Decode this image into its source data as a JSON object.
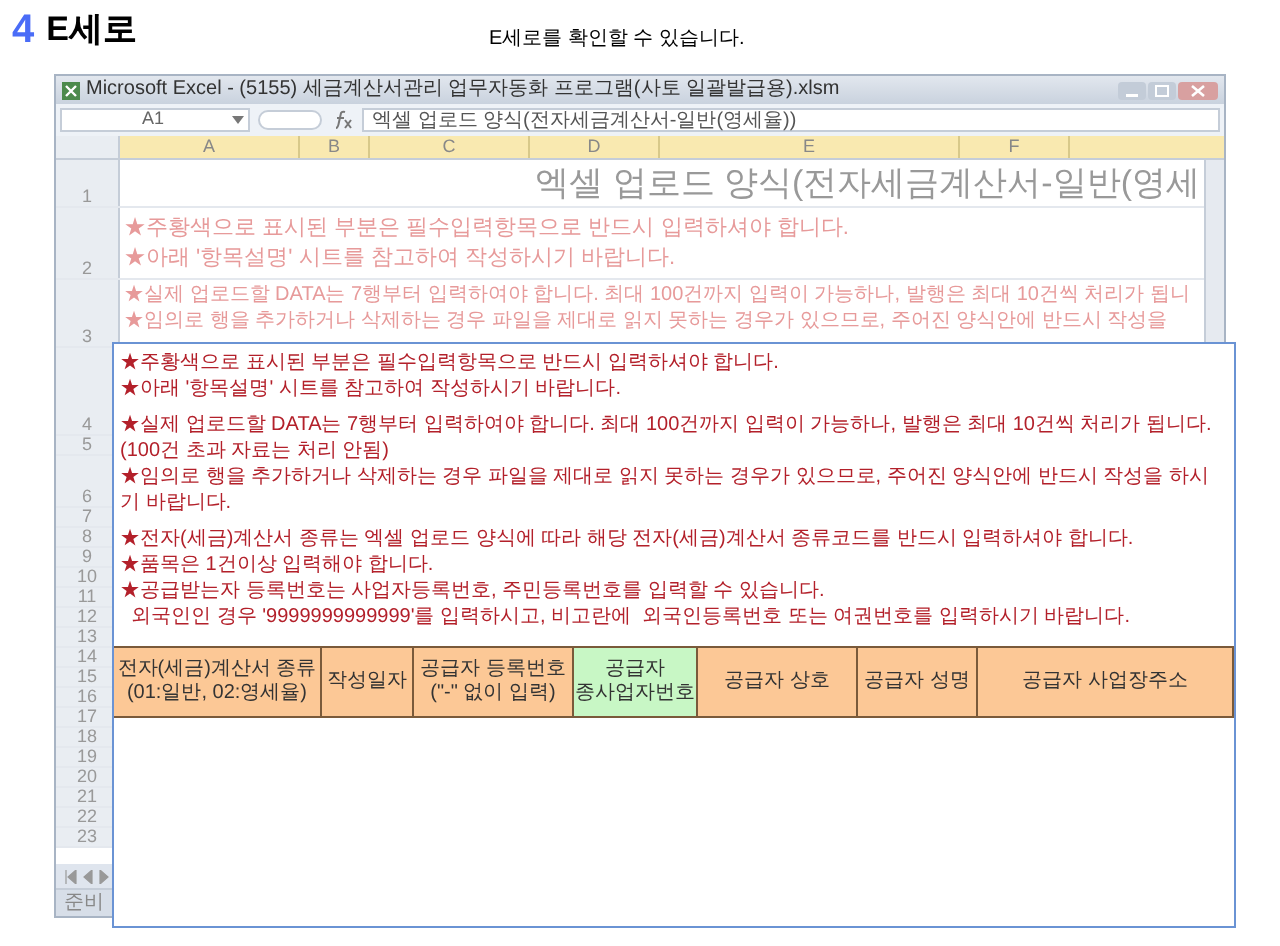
{
  "page": {
    "step_number": "4",
    "title": "E세로",
    "caption": "E세로를 확인할 수 있습니다."
  },
  "excel": {
    "title": "Microsoft Excel - (5155) 세금계산서관리 업무자동화 프로그램(사토 일괄발급용).xlsm",
    "name_box": "A1",
    "formula": "엑셀 업로드 양식(전자세금계산서-일반(영세율))",
    "columns": [
      "A",
      "B",
      "C",
      "D",
      "E",
      "F"
    ],
    "rows": [
      {
        "number": "1",
        "kind": "title",
        "lines": [
          "엑셀 업로드 양식(전자세금계산서-일반(영세"
        ]
      },
      {
        "number": "2",
        "kind": "notes",
        "lines": [
          "★주황색으로 표시된 부분은 필수입력항목으로 반드시 입력하셔야 합니다.",
          "★아래 '항목설명' 시트를 참고하여 작성하시기 바랍니다."
        ]
      },
      {
        "number": "3",
        "kind": "notes_small",
        "lines": [
          "★실제 업로드할 DATA는 7행부터 입력하여야 합니다. 최대 100건까지 입력이 가능하나, 발행은 최대 10건씩 처리가 됩니",
          "★임의로 행을 추가하거나 삭제하는 경우 파일을 제대로 읽지 못하는 경우가 있으므로, 주어진 양식안에 반드시 작성을"
        ]
      },
      {
        "number": "4",
        "kind": "tall"
      },
      {
        "number": "5",
        "kind": "thin"
      },
      {
        "number": "6",
        "kind": "header"
      },
      {
        "number": "7",
        "kind": "blank"
      },
      {
        "number": "8",
        "kind": "blank"
      },
      {
        "number": "9",
        "kind": "blank"
      },
      {
        "number": "10",
        "kind": "blank"
      },
      {
        "number": "11",
        "kind": "blank"
      },
      {
        "number": "12",
        "kind": "blank"
      },
      {
        "number": "13",
        "kind": "blank"
      },
      {
        "number": "14",
        "kind": "blank"
      },
      {
        "number": "15",
        "kind": "blank"
      },
      {
        "number": "16",
        "kind": "blank"
      },
      {
        "number": "17",
        "kind": "blank"
      },
      {
        "number": "18",
        "kind": "blank"
      },
      {
        "number": "19",
        "kind": "blank"
      },
      {
        "number": "20",
        "kind": "blank"
      },
      {
        "number": "21",
        "kind": "blank"
      },
      {
        "number": "22",
        "kind": "blank"
      },
      {
        "number": "23",
        "kind": "blank"
      }
    ],
    "status": "준비"
  },
  "note_panel": {
    "groups": [
      [
        "★주황색으로 표시된 부분은 필수입력항목으로 반드시 입력하셔야 합니다.",
        "★아래 '항목설명' 시트를 참고하여 작성하시기 바랍니다."
      ],
      [
        "★실제 업로드할 DATA는 7행부터 입력하여야 합니다. 최대 100건까지 입력이 가능하나, 발행은 최대 10건씩 처리가 됩니다.(100건 초과 자료는 처리 안됨)",
        "★임의로 행을 추가하거나 삭제하는 경우 파일을 제대로 읽지 못하는 경우가 있으므로, 주어진 양식안에 반드시 작성을 하시기 바랍니다."
      ],
      [
        "★전자(세금)계산서 종류는 엑셀 업로드 양식에 따라 해당 전자(세금)계산서 종류코드를 반드시 입력하셔야 합니다.",
        "★품목은 1건이상 입력해야 합니다.",
        "★공급받는자 등록번호는 사업자등록번호, 주민등록번호를 입력할 수 있습니다.",
        "  외국인인 경우 '9999999999999'를 입력하시고, 비고란에  외국인등록번호 또는 여권번호를 입력하시기 바랍니다."
      ]
    ],
    "table_columns": [
      {
        "label": "전자(세금)계산서 종류\n(01:일반, 02:영세율)",
        "color": "#fcc896"
      },
      {
        "label": "작성일자",
        "color": "#fcc896"
      },
      {
        "label": "공급자 등록번호\n(\"-\" 없이 입력)",
        "color": "#fcc896"
      },
      {
        "label": "공급자\n종사업자번호",
        "color": "#c8f7c5"
      },
      {
        "label": "공급자 상호",
        "color": "#fcc896"
      },
      {
        "label": "공급자 성명",
        "color": "#fcc896"
      },
      {
        "label": "공급자 사업장주소",
        "color": "#fcc896"
      }
    ]
  }
}
